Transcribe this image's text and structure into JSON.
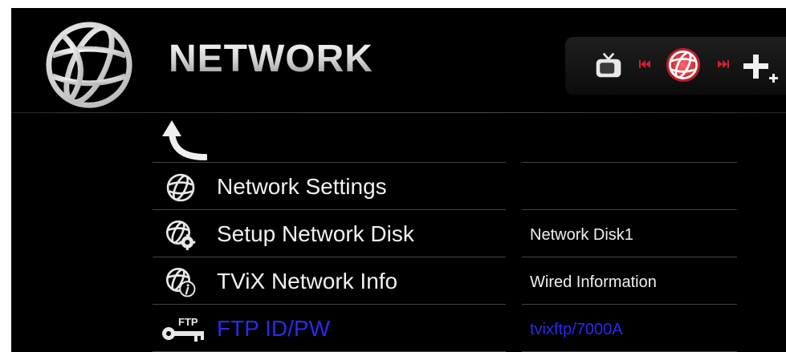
{
  "header": {
    "title": "NETWORK"
  },
  "nav": {
    "items": [
      {
        "icon": "tv-icon"
      },
      {
        "icon": "skip-back-icon"
      },
      {
        "icon": "globe-icon",
        "active": true
      },
      {
        "icon": "skip-forward-icon"
      },
      {
        "icon": "plus-icon"
      }
    ]
  },
  "menu": {
    "back_icon": "back-arrow-icon",
    "items": [
      {
        "label": "Network Settings",
        "value": "",
        "icon": "globe-icon"
      },
      {
        "label": "Setup Network Disk",
        "value": "Network Disk1",
        "icon": "globe-gear-icon"
      },
      {
        "label": "TViX Network Info",
        "value": "Wired Information",
        "icon": "globe-info-icon"
      },
      {
        "label": "FTP ID/PW",
        "value": "tvixftp/7000A",
        "icon": "ftp-key-icon",
        "selected": true
      }
    ]
  },
  "colors": {
    "background": "#000000",
    "text": "#f2f2f2",
    "selected_text": "#2a2af0",
    "nav_active": "#e0303a"
  }
}
